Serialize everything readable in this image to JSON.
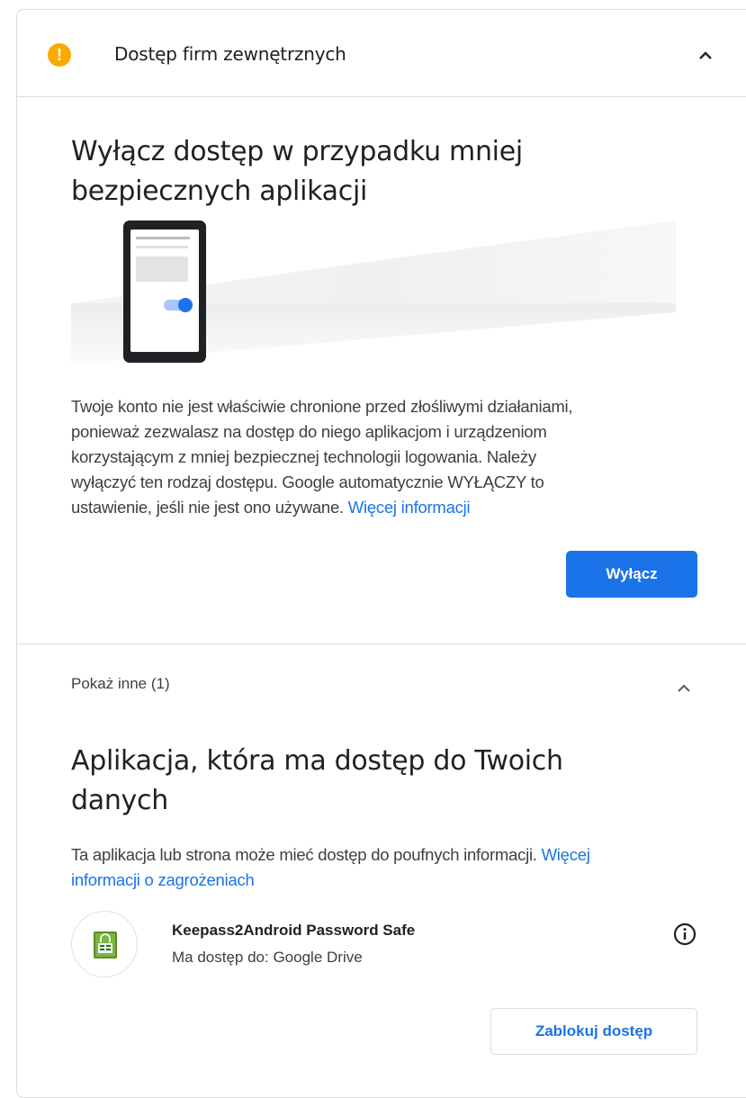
{
  "header": {
    "title": "Dostęp firm zewnętrznych",
    "warning_glyph": "!",
    "icon": "warning-icon",
    "accent": "#f9ab00"
  },
  "insecure_apps": {
    "title_line1": "Wyłącz dostęp w przypadku mniej",
    "title_line2": "bezpiecznych aplikacji",
    "body_lines": [
      "Twoje konto nie jest właściwie chronione przed złośliwymi działaniami,",
      "ponieważ zezwalasz na dostęp do niego aplikacjom i urządzeniom",
      "korzystającym z mniej bezpiecznej technologii logowania. Należy",
      "wyłączyć ten rodzaj dostępu. Google automatycznie WYŁĄCZY to",
      "ustawienie, jeśli nie jest ono używane."
    ],
    "more_info_link": "Więcej informacji",
    "turn_off_button": "Wyłącz",
    "button_color": "#1a73e8"
  },
  "other": {
    "show_other_label": "Pokaż inne (1)",
    "title_line1": "Aplikacja, która ma dostęp do Twoich",
    "title_line2": "danych",
    "body_text": "Ta aplikacja lub strona może mieć dostęp do poufnych informacji.",
    "risk_link_part1": "Więcej",
    "risk_link_part2": "informacji o zagrożeniach",
    "app": {
      "name": "Keepass2Android Password Safe",
      "access": "Ma dostęp do: Google Drive",
      "logo_icon": "keepass-logo-icon",
      "info_icon": "info-icon"
    },
    "block_button": "Zablokuj dostęp"
  }
}
